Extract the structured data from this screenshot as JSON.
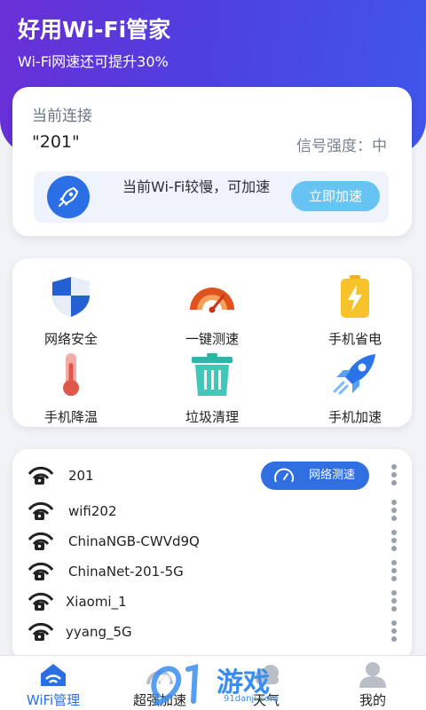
{
  "header": {
    "title": "好用Wi-Fi管家",
    "subtitle": "Wi-Fi网速还可提升30%"
  },
  "connection": {
    "label": "当前连接",
    "ssid": "\"201\"",
    "signal": "信号强度：中",
    "slow_message": "当前Wi-Fi较慢，可加速",
    "boost_button": "立即加速"
  },
  "tools": [
    {
      "label": "网络安全",
      "icon": "shield-icon"
    },
    {
      "label": "一键测速",
      "icon": "speedometer-icon"
    },
    {
      "label": "手机省电",
      "icon": "battery-icon"
    },
    {
      "label": "手机降温",
      "icon": "thermometer-icon"
    },
    {
      "label": "垃圾清理",
      "icon": "trash-icon"
    },
    {
      "label": "手机加速",
      "icon": "rocket-icon"
    }
  ],
  "wifi_list": {
    "speed_test_button": "网络测速",
    "networks": [
      {
        "name": "201"
      },
      {
        "name": "wifi202"
      },
      {
        "name": "ChinaNGB-CWVd9Q"
      },
      {
        "name": "ChinaNet-201-5G"
      },
      {
        "name": "Xiaomi_1"
      },
      {
        "name": "yyang_5G"
      }
    ]
  },
  "tabbar": {
    "tabs": [
      {
        "label": "WiFi管理",
        "icon": "wifi-home-icon",
        "active": true
      },
      {
        "label": "超强加速",
        "icon": "speed-icon",
        "active": false
      },
      {
        "label": "天气",
        "icon": "cloud-icon",
        "active": false
      },
      {
        "label": "我的",
        "icon": "user-icon",
        "active": false
      }
    ]
  },
  "watermark": {
    "brand": "游戏",
    "url": "91danji.com"
  },
  "colors": {
    "header_gradient_start": "#6a2fd6",
    "header_gradient_end": "#3f57ea",
    "primary_blue": "#2a6fe6",
    "boost_button": "#67c3f2"
  }
}
